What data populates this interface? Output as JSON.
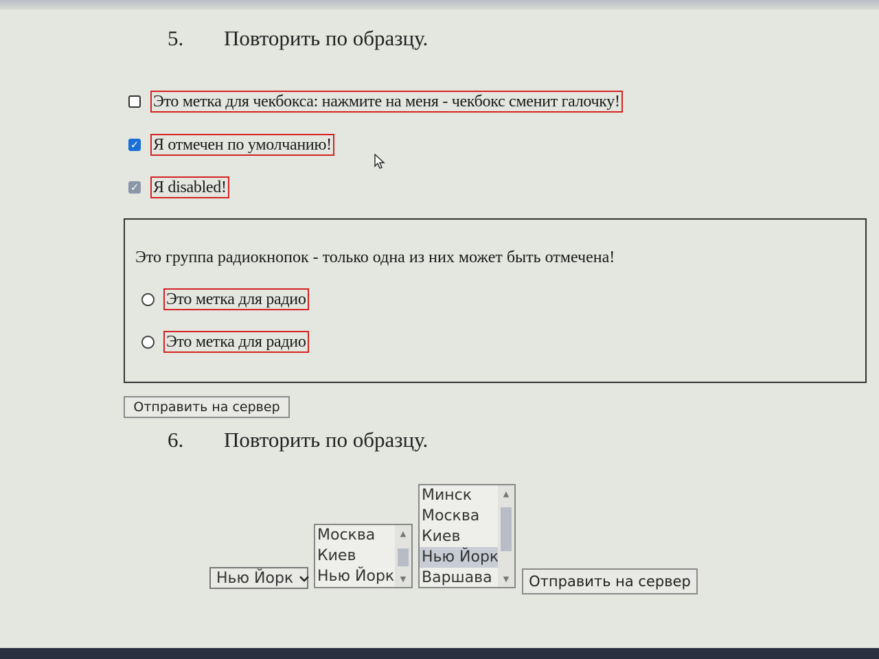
{
  "section5": {
    "number": "5.",
    "title": "Повторить по образцу."
  },
  "checkboxes": [
    {
      "label": "Это метка для чекбокса: нажмите на меня - чекбокс сменит галочку!",
      "checked": false,
      "disabled": false
    },
    {
      "label": "Я отмечен по умолчанию!",
      "checked": true,
      "disabled": false
    },
    {
      "label": "Я disabled!",
      "checked": true,
      "disabled": true
    }
  ],
  "radio_group": {
    "caption": "Это группа радиокнопок - только одна из них может быть отмечена!",
    "options": [
      {
        "label": "Это метка для радио",
        "checked": false
      },
      {
        "label": "Это метка для радио",
        "checked": false
      }
    ]
  },
  "submit_button_1": "Отправить на сервер",
  "section6": {
    "number": "6.",
    "title": "Повторить по образцу."
  },
  "city_select": {
    "selected": "Нью Йорк"
  },
  "listbox_small": {
    "items": [
      "Москва",
      "Киев",
      "Нью Йорк"
    ],
    "selected_index": null
  },
  "listbox_large": {
    "items": [
      "Минск",
      "Москва",
      "Киев",
      "Нью Йорк",
      "Варшава"
    ],
    "selected_index": 3
  },
  "submit_button_2": "Отправить на сервер",
  "colors": {
    "label_border": "#d42222",
    "checkbox_accent": "#1a6fd6",
    "background": "#e4e6e0"
  }
}
